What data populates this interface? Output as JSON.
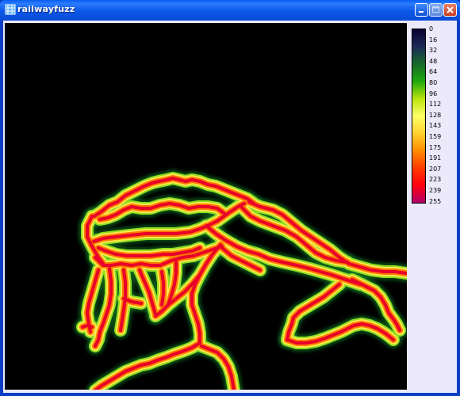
{
  "window": {
    "title": "railwayfuzz"
  },
  "title_controls": {
    "minimize_icon": "minimize-icon",
    "maximize_icon": "maximize-icon",
    "close_icon": "close-icon"
  },
  "legend": {
    "ticks": [
      "0",
      "16",
      "32",
      "48",
      "64",
      "80",
      "96",
      "112",
      "128",
      "143",
      "159",
      "175",
      "191",
      "207",
      "223",
      "239",
      "255"
    ],
    "gradient_stops": [
      "#0b0030",
      "#1b2a58",
      "#1a6b2a",
      "#1ea80c",
      "#b8e30d",
      "#ffff66",
      "#ffd230",
      "#ff8c00",
      "#ff3a00",
      "#ff0010",
      "#b0006a"
    ]
  },
  "colors": {
    "title_bar": "#0b57e6",
    "client_background": "#ece9fb",
    "heatmap_background": "#000000",
    "glow_outer": "#1a8a2c",
    "glow_mid": "#8ee020",
    "glow_inner": "#ffe64d",
    "track_outer": "#ff7a00",
    "track_core": "#e8002a"
  }
}
